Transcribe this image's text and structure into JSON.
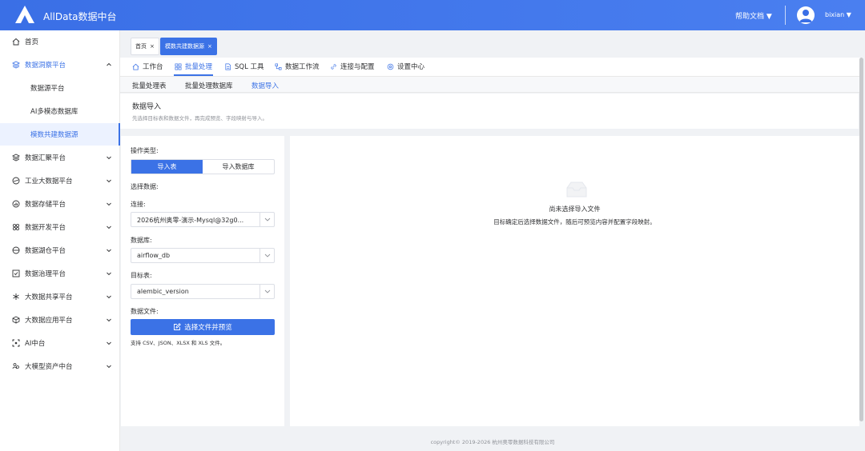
{
  "header": {
    "app_title": "AllData数据中台",
    "help_label": "帮助文档 ▼",
    "user_label": "bixian ▼"
  },
  "sidebar": {
    "items": [
      {
        "label": "首页",
        "icon": "home-icon"
      },
      {
        "label": "数据洞察平台",
        "icon": "layers-icon"
      },
      {
        "label": "数据汇聚平台",
        "icon": "layers-icon"
      },
      {
        "label": "工业大数据平台",
        "icon": "disc-icon"
      },
      {
        "label": "数据存储平台",
        "icon": "chart-icon"
      },
      {
        "label": "数据开发平台",
        "icon": "cluster-icon"
      },
      {
        "label": "数据湖仓平台",
        "icon": "database-icon"
      },
      {
        "label": "数据治理平台",
        "icon": "check-icon"
      },
      {
        "label": "大数据共享平台",
        "icon": "snowflake-icon"
      },
      {
        "label": "大数据应用平台",
        "icon": "box-icon"
      },
      {
        "label": "AI中台",
        "icon": "ai-icon"
      },
      {
        "label": "大模型资产中台",
        "icon": "people-icon"
      }
    ],
    "sub_items": [
      "数据源平台",
      "AI多模态数据库",
      "模数共建数据源"
    ]
  },
  "tags": [
    {
      "label": "首页"
    },
    {
      "label": "模数共建数据源"
    }
  ],
  "modules": [
    "工作台",
    "批量处理",
    "SQL 工具",
    "数据工作流",
    "连接与配置",
    "设置中心"
  ],
  "subtabs": [
    "批量处理表",
    "批量处理数据库",
    "数据导入"
  ],
  "page": {
    "title": "数据导入",
    "desc": "先选择目标表和数据文件，再完成预览、字段映射与导入。"
  },
  "form": {
    "op_type_label": "操作类型:",
    "seg_import_table": "导入表",
    "seg_import_db": "导入数据库",
    "select_data_label": "选择数据:",
    "conn_label": "连接:",
    "conn_value": "2026杭州奥零-演示-Mysql@32g0...",
    "db_label": "数据库:",
    "db_value": "airflow_db",
    "table_label": "目标表:",
    "table_value": "alembic_version",
    "file_label": "数据文件:",
    "pick_button": "选择文件并预览",
    "hint": "支持 CSV、JSON、XLSX 和 XLS 文件。"
  },
  "empty": {
    "title": "尚未选择导入文件",
    "desc": "目标确定后选择数据文件，随后可预览内容并配置字段映射。"
  },
  "footer": "copyright© 2019-2026 杭州奥零数据科技有限公司",
  "colors": {
    "accent": "#3b72e6"
  }
}
